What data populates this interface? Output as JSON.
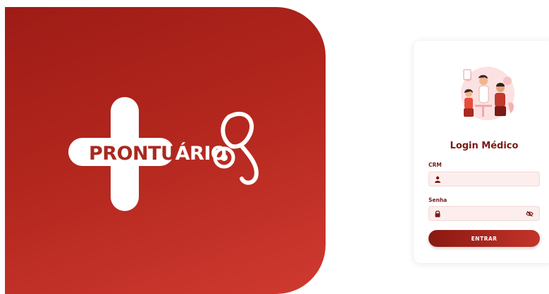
{
  "brand": {
    "logo_part1": "PRONTU",
    "logo_part2": "ÁRIO"
  },
  "login": {
    "title": "Login Médico",
    "crm_label": "CRM",
    "crm_value": "",
    "password_label": "Senha",
    "password_value": "",
    "submit_label": "ENTRAR"
  },
  "colors": {
    "primary": "#a82a21",
    "primary_dark": "#7a1a14",
    "field_bg": "#fdeeee"
  }
}
